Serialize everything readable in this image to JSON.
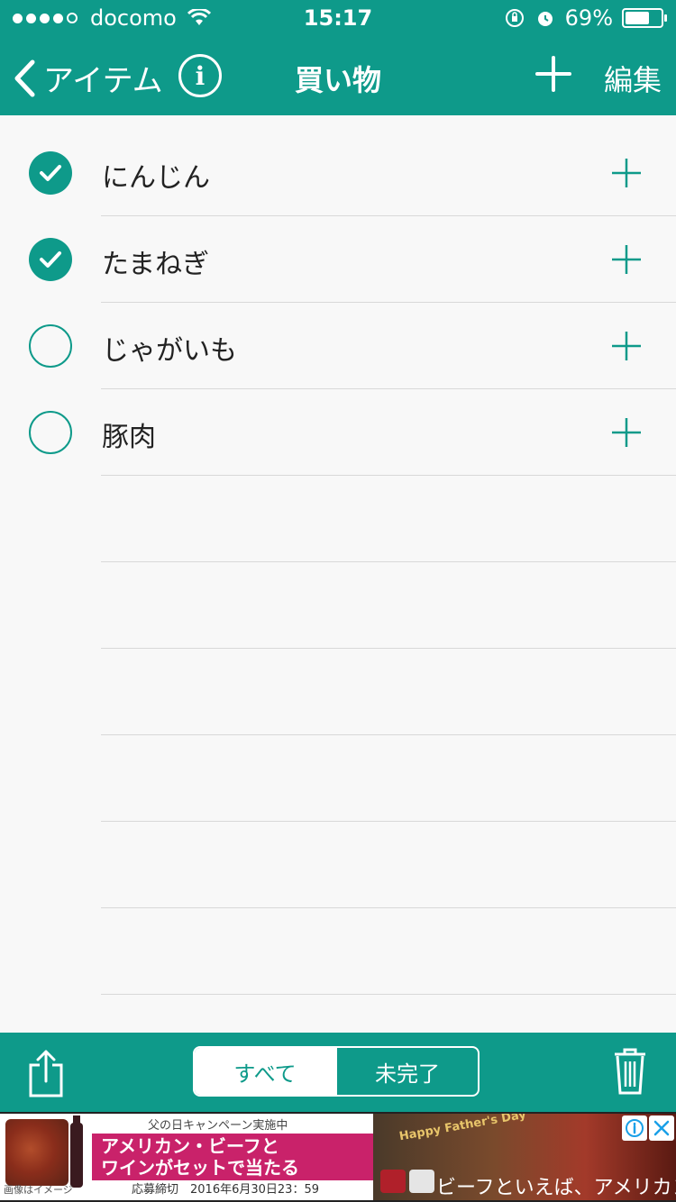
{
  "status_bar": {
    "carrier": "docomo",
    "time": "15:17",
    "battery": "69%",
    "battery_level": 0.69
  },
  "nav": {
    "back_label": "アイテム",
    "info_label": "i",
    "title": "買い物",
    "edit_label": "編集"
  },
  "items": [
    {
      "name": "にんじん",
      "checked": true
    },
    {
      "name": "たまねぎ",
      "checked": true
    },
    {
      "name": "じゃがいも",
      "checked": false
    },
    {
      "name": "豚肉",
      "checked": false
    }
  ],
  "empty_rows": 6,
  "bottom_bar": {
    "segments": [
      "すべて",
      "未完了"
    ],
    "active_segment": "すべて"
  },
  "ad": {
    "campaign": "父の日キャンペーン実施中",
    "headline_line1": "アメリカン・ビーフと",
    "headline_line2": "ワインがセットで当たる",
    "image_note": "画像はイメージ",
    "deadline": "応募締切　2016年6月30日23：59",
    "fathers_day": "Happy Father's Day",
    "slogan": "ビーフといえば、アメリカン"
  },
  "colors": {
    "accent": "#0e9a8a",
    "background": "#f8f8f8",
    "separator": "#d8d8d8"
  },
  "icons": {
    "back": "chevron-left-icon",
    "info": "info-icon",
    "add": "plus-icon",
    "check_done": "checkmark-circle-icon",
    "check_todo": "empty-circle-icon",
    "row_add": "plus-icon",
    "share": "share-icon",
    "trash": "trash-icon"
  }
}
